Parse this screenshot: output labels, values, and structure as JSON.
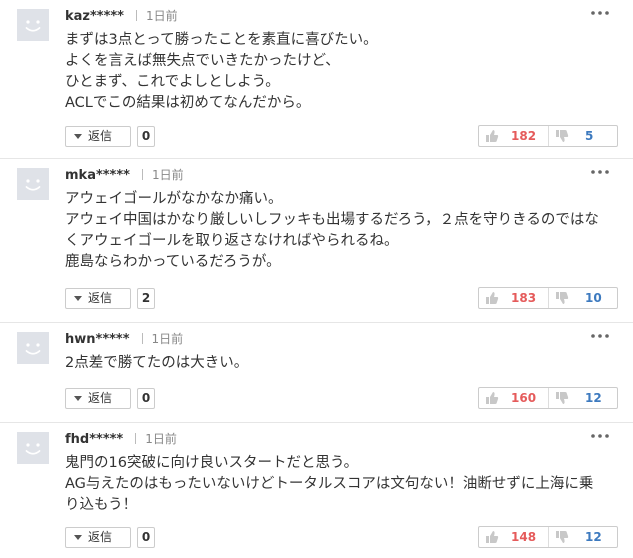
{
  "colors": {
    "avatar_bg": "#dfe2e8",
    "agree": "#e55b5b",
    "disagree": "#3d7abf",
    "border": "#cccccc"
  },
  "icons": {
    "avatar": "smiley-face-icon",
    "more": "more-dots-icon",
    "reply_caret": "caret-down-icon",
    "agree": "thumbs-up-icon",
    "disagree": "thumbs-down-icon"
  },
  "comments": [
    {
      "username": "kaz*****",
      "time": "1日前",
      "body": "まずは3点とって勝ったことを素直に喜びたい。\nよくを言えば無失点でいきたかったけど、\nひとまず、これでよしとしよう。\nACLでこの結果は初めてなんだから。",
      "reply_label": "返信",
      "reply_count": "0",
      "agree": "182",
      "disagree": "5"
    },
    {
      "username": "mka*****",
      "time": "1日前",
      "body": "アウェイゴールがなかなか痛い。\nアウェイ中国はかなり厳しいしフッキも出場するだろう，２点を守りきるのではな\nくアウェイゴールを取り返さなければやられるね。\n鹿島ならわかっているだろうが。",
      "reply_label": "返信",
      "reply_count": "2",
      "agree": "183",
      "disagree": "10"
    },
    {
      "username": "hwn*****",
      "time": "1日前",
      "body": "2点差で勝てたのは大きい。",
      "reply_label": "返信",
      "reply_count": "0",
      "agree": "160",
      "disagree": "12"
    },
    {
      "username": "fhd*****",
      "time": "1日前",
      "body": "鬼門の16突破に向け良いスタートだと思う。\nAG与えたのはもったいないけどトータルスコアは文句ない！油断せずに上海に乗\nり込もう！",
      "reply_label": "返信",
      "reply_count": "0",
      "agree": "148",
      "disagree": "12"
    }
  ]
}
